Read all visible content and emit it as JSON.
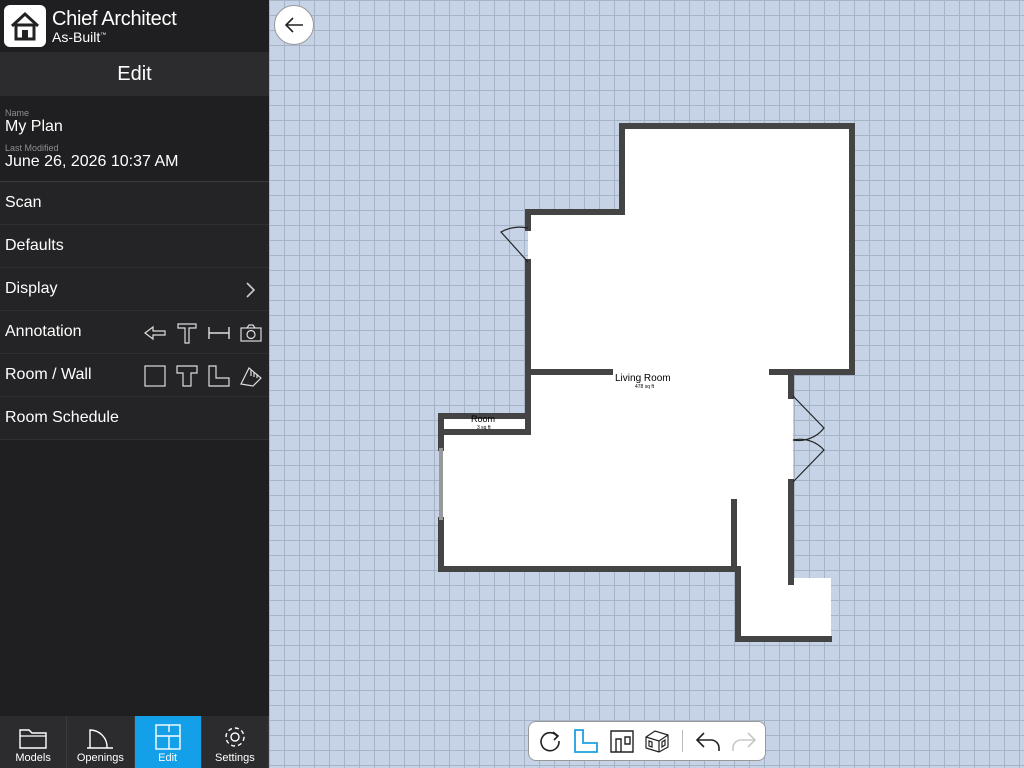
{
  "brand": {
    "line1": "Chief Architect",
    "line2": "As-Built",
    "trademark": "™"
  },
  "panel": {
    "title": "Edit",
    "name_label": "Name",
    "name_value": "My Plan",
    "modified_label": "Last Modified",
    "modified_value": "June 26, 2026 10:37 AM"
  },
  "menu": {
    "scan": "Scan",
    "defaults": "Defaults",
    "display": "Display",
    "annotation": "Annotation",
    "room_wall": "Room / Wall",
    "room_schedule": "Room Schedule"
  },
  "tabs": [
    {
      "label": "Models",
      "icon": "folder-icon"
    },
    {
      "label": "Openings",
      "icon": "door-arc-icon"
    },
    {
      "label": "Edit",
      "icon": "floorplan-icon",
      "active": true
    },
    {
      "label": "Settings",
      "icon": "gear-icon"
    }
  ],
  "rooms": [
    {
      "name": "Living Room",
      "area": "478 sq ft"
    },
    {
      "name": "Room",
      "area": "3 sq ft"
    }
  ],
  "colors": {
    "accent": "#14a0e8",
    "canvas": "#c6d3e6",
    "wall": "#444444"
  }
}
